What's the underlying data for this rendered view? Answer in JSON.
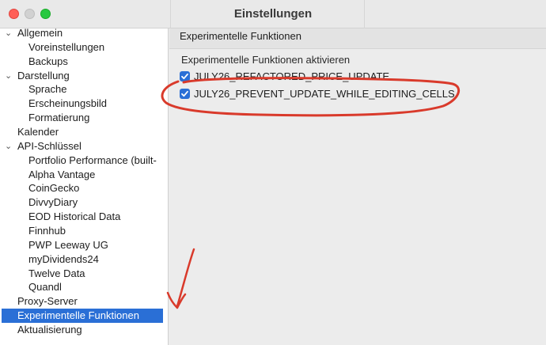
{
  "window": {
    "title": "Einstellungen"
  },
  "sidebar": {
    "items": [
      {
        "label": "Allgemein",
        "chevron": "⌄"
      },
      {
        "label": "Voreinstellungen"
      },
      {
        "label": "Backups"
      },
      {
        "label": "Darstellung",
        "chevron": "⌄"
      },
      {
        "label": "Sprache"
      },
      {
        "label": "Erscheinungsbild"
      },
      {
        "label": "Formatierung"
      },
      {
        "label": "Kalender"
      },
      {
        "label": "API-Schlüssel",
        "chevron": "⌄"
      },
      {
        "label": "Portfolio Performance (built-"
      },
      {
        "label": "Alpha Vantage"
      },
      {
        "label": "CoinGecko"
      },
      {
        "label": "DivvyDiary"
      },
      {
        "label": "EOD Historical Data"
      },
      {
        "label": "Finnhub"
      },
      {
        "label": "PWP Leeway UG"
      },
      {
        "label": "myDividends24"
      },
      {
        "label": "Twelve Data"
      },
      {
        "label": "Quandl"
      },
      {
        "label": "Proxy-Server"
      },
      {
        "label": "Experimentelle Funktionen",
        "selected": true
      },
      {
        "label": "Aktualisierung"
      }
    ]
  },
  "main": {
    "section_title": "Experimentelle Funktionen",
    "group_label": "Experimentelle Funktionen aktivieren",
    "options": [
      {
        "label": "JULY26_REFACTORED_PRICE_UPDATE",
        "checked": true
      },
      {
        "label": "JULY26_PREVENT_UPDATE_WHILE_EDITING_CELLS",
        "checked": true
      }
    ]
  },
  "colors": {
    "selection": "#2a6fd6",
    "annotation": "#d93a2b"
  }
}
